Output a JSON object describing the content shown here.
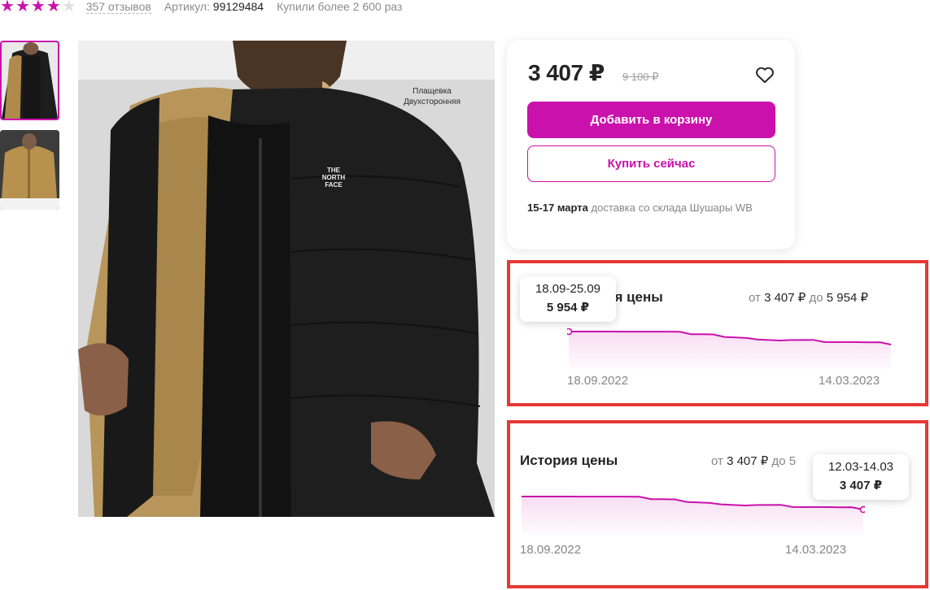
{
  "product": {
    "rating_stars": 4,
    "max_stars": 5,
    "reviews": "357 отзывов",
    "article_label": "Артикул:",
    "article_value": "99129484",
    "bought": "Купили более 2 600 раз",
    "photo_caption_line1": "Плащевка",
    "photo_caption_line2": "Двухсторонняя"
  },
  "price_card": {
    "price": "3 407 ₽",
    "old_price": "9 100 ₽",
    "add_to_cart": "Добавить в корзину",
    "buy_now": "Купить сейчас",
    "delivery_date": "15-17 марта",
    "delivery_text": " доставка со склада Шушары WB",
    "accent_color": "#cb11ab"
  },
  "history_1": {
    "title": "История цены",
    "title_visible": "ия цены",
    "range_from_label": "от ",
    "range_from": "3 407 ₽",
    "range_to_label": " до ",
    "range_to": "5 954 ₽",
    "start_date": "18.09.2022",
    "end_date": "14.03.2023",
    "tooltip_range": "18.09-25.09",
    "tooltip_price": "5 954 ₽"
  },
  "history_2": {
    "title": "История цены",
    "range_from_label": "от ",
    "range_from": "3 407 ₽",
    "range_to_label": " до 5",
    "start_date": "18.09.2022",
    "end_date": "14.03.2023",
    "tooltip_range": "12.03-14.03",
    "tooltip_price": "3 407 ₽"
  },
  "chart_data": {
    "type": "area",
    "x_start": "18.09.2022",
    "x_end": "14.03.2023",
    "y_min": 3407,
    "y_max": 5954,
    "series": [
      {
        "values": [
          5954,
          5954,
          5954,
          5950,
          5950,
          5940,
          5940,
          5944,
          5944,
          5940,
          5900,
          5450,
          5440,
          5400,
          4900,
          4800,
          4700,
          4400,
          4300,
          4200,
          4300,
          4300,
          4320,
          3900,
          3880,
          3900,
          3880,
          3850,
          3870,
          3407
        ]
      }
    ]
  }
}
